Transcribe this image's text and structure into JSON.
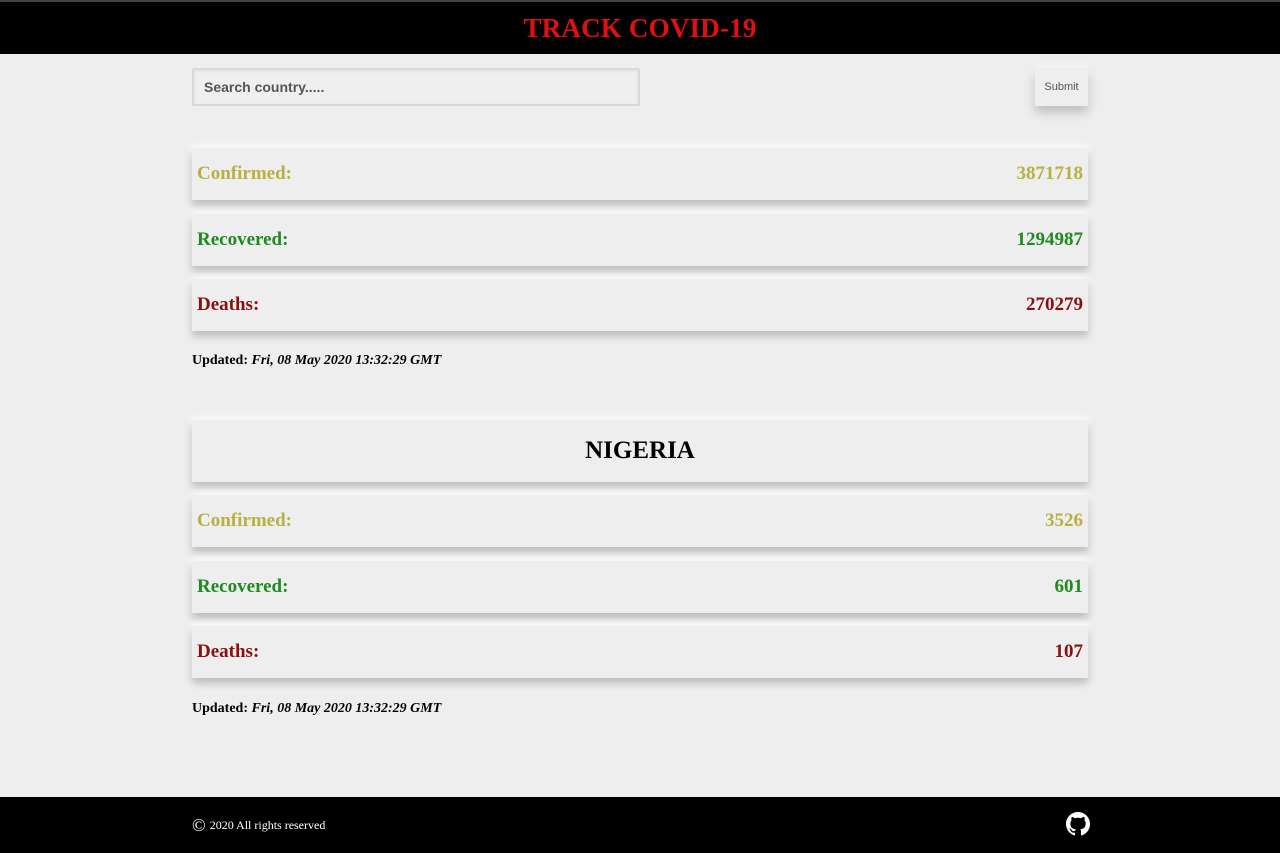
{
  "header": {
    "title": "TRACK COVID-19"
  },
  "search": {
    "placeholder": "Search country.....",
    "value": "",
    "submit_label": "Submit"
  },
  "global": {
    "confirmed_label": "Confirmed:",
    "confirmed_value": "3871718",
    "recovered_label": "Recovered:",
    "recovered_value": "1294987",
    "deaths_label": "Deaths:",
    "deaths_value": "270279",
    "updated_label": "Updated:",
    "updated_time": "Fri, 08 May 2020 13:32:29 GMT"
  },
  "country": {
    "name": "NIGERIA",
    "confirmed_label": "Confirmed:",
    "confirmed_value": "3526",
    "recovered_label": "Recovered:",
    "recovered_value": "601",
    "deaths_label": "Deaths:",
    "deaths_value": "107",
    "updated_label": "Updated:",
    "updated_time": "Fri, 08 May 2020 13:32:29 GMT"
  },
  "footer": {
    "copyright_symbol": "©",
    "copyright_text": "2020 All rights reserved",
    "github_icon": "github-icon"
  },
  "colors": {
    "title": "#e01010",
    "confirmed": "#b8b040",
    "recovered": "#1f8a1f",
    "deaths": "#8a1010",
    "bars": "#000000",
    "background": "#eeeeee"
  }
}
